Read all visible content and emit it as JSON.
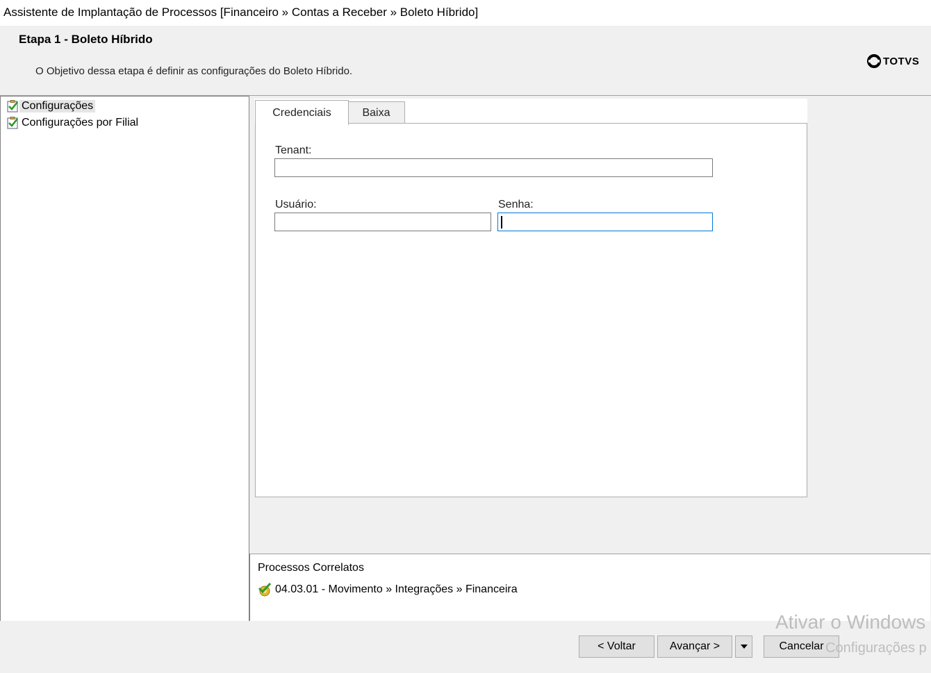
{
  "window": {
    "title": "Assistente de Implantação de Processos [Financeiro » Contas a Receber » Boleto Híbrido]"
  },
  "header": {
    "step_title": "Etapa 1 - Boleto Híbrido",
    "step_description": "O Objetivo dessa etapa é definir as configurações do Boleto Híbrido.",
    "logo_text": "TOTVS"
  },
  "tree": {
    "items": [
      {
        "label": "Configurações",
        "selected": true,
        "icon": "checked-clipboard-icon"
      },
      {
        "label": "Configurações por Filial",
        "selected": false,
        "icon": "checked-clipboard-icon"
      }
    ]
  },
  "tabs": [
    {
      "label": "Credenciais",
      "active": true
    },
    {
      "label": "Baixa",
      "active": false
    }
  ],
  "form": {
    "tenant_label": "Tenant:",
    "tenant_value": "",
    "usuario_label": "Usuário:",
    "usuario_value": "",
    "senha_label": "Senha:",
    "senha_value": ""
  },
  "related": {
    "title": "Processos Correlatos",
    "items": [
      {
        "label": "04.03.01 - Movimento » Integrações » Financeira",
        "icon": "process-check-icon"
      }
    ]
  },
  "footer": {
    "back_label": "< Voltar",
    "next_label": "Avançar >",
    "dropdown_icon": "triangle-down-icon",
    "cancel_label": "Cancelar"
  },
  "watermark": {
    "line1": "Ativar o Windows",
    "line2": "Configurações p"
  },
  "colors": {
    "background": "#f0f0f0",
    "focus_border": "#0078d7",
    "panel_border": "#adadad"
  }
}
